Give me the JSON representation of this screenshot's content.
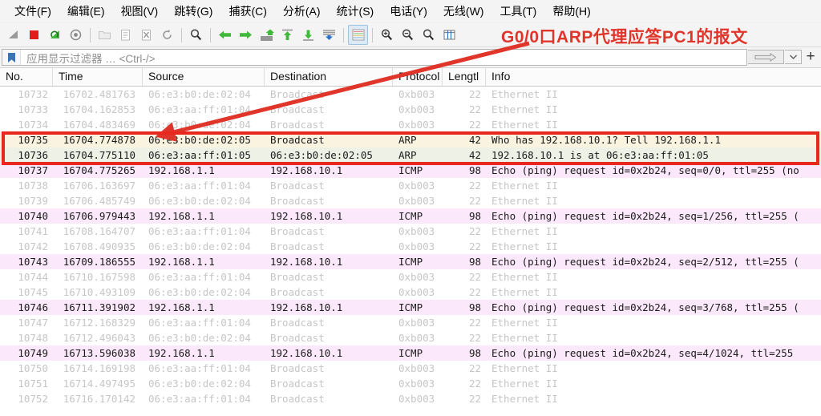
{
  "menu": {
    "items": [
      {
        "label": "文件(F)",
        "name": "menu-file"
      },
      {
        "label": "编辑(E)",
        "name": "menu-edit"
      },
      {
        "label": "视图(V)",
        "name": "menu-view"
      },
      {
        "label": "跳转(G)",
        "name": "menu-go"
      },
      {
        "label": "捕获(C)",
        "name": "menu-capture"
      },
      {
        "label": "分析(A)",
        "name": "menu-analyze"
      },
      {
        "label": "统计(S)",
        "name": "menu-statistics"
      },
      {
        "label": "电话(Y)",
        "name": "menu-telephony"
      },
      {
        "label": "无线(W)",
        "name": "menu-wireless"
      },
      {
        "label": "工具(T)",
        "name": "menu-tools"
      },
      {
        "label": "帮助(H)",
        "name": "menu-help"
      }
    ]
  },
  "toolbar": {
    "icons": [
      "start-capture-icon",
      "stop-capture-icon",
      "restart-capture-icon",
      "capture-options-icon",
      "open-file-icon",
      "save-file-icon",
      "close-file-icon",
      "reload-icon",
      "find-packet-icon",
      "go-back-icon",
      "go-forward-icon",
      "go-to-packet-icon",
      "go-first-packet-icon",
      "go-last-packet-icon",
      "autoscroll-icon",
      "colorize-icon",
      "zoom-in-icon",
      "zoom-out-icon",
      "zoom-reset-icon",
      "resize-columns-icon"
    ]
  },
  "filter": {
    "bookmark_icon": "bookmark-icon",
    "placeholder": "应用显示过滤器 … <Ctrl-/>",
    "value": "",
    "apply_icon": "apply-filter-arrow-icon",
    "dropdown_icon": "chevron-down-icon",
    "add_label": "+"
  },
  "annotation": {
    "text": "G0/0口ARP代理应答PC1的报文",
    "color": "#e0352b"
  },
  "packet_list": {
    "columns": [
      {
        "label": "No.",
        "name": "column-no"
      },
      {
        "label": "Time",
        "name": "column-time"
      },
      {
        "label": "Source",
        "name": "column-source"
      },
      {
        "label": "Destination",
        "name": "column-destination"
      },
      {
        "label": "Protocol",
        "name": "column-protocol"
      },
      {
        "label": "Lengtl",
        "name": "column-length"
      },
      {
        "label": "Info",
        "name": "column-info"
      }
    ],
    "rows": [
      {
        "no": "10732",
        "time": "16702.481763",
        "src": "06:e3:b0:de:02:04",
        "dst": "Broadcast",
        "proto": "0xb003",
        "len": "22",
        "info": "Ethernet II",
        "style": "row-eth"
      },
      {
        "no": "10733",
        "time": "16704.162853",
        "src": "06:e3:aa:ff:01:04",
        "dst": "Broadcast",
        "proto": "0xb003",
        "len": "22",
        "info": "Ethernet II",
        "style": "row-eth"
      },
      {
        "no": "10734",
        "time": "16704.483469",
        "src": "06:e3:b0:de:02:04",
        "dst": "Broadcast",
        "proto": "0xb003",
        "len": "22",
        "info": "Ethernet II",
        "style": "row-eth"
      },
      {
        "no": "10735",
        "time": "16704.774878",
        "src": "06:e3:b0:de:02:05",
        "dst": "Broadcast",
        "proto": "ARP",
        "len": "42",
        "info": "Who has 192.168.10.1? Tell 192.168.1.1",
        "style": "row-arp"
      },
      {
        "no": "10736",
        "time": "16704.775110",
        "src": "06:e3:aa:ff:01:05",
        "dst": "06:e3:b0:de:02:05",
        "proto": "ARP",
        "len": "42",
        "info": "192.168.10.1 is at 06:e3:aa:ff:01:05",
        "style": "row-arp2"
      },
      {
        "no": "10737",
        "time": "16704.775265",
        "src": "192.168.1.1",
        "dst": "192.168.10.1",
        "proto": "ICMP",
        "len": "98",
        "info": "Echo (ping) request  id=0x2b24, seq=0/0, ttl=255 (no",
        "style": "row-icmp"
      },
      {
        "no": "10738",
        "time": "16706.163697",
        "src": "06:e3:aa:ff:01:04",
        "dst": "Broadcast",
        "proto": "0xb003",
        "len": "22",
        "info": "Ethernet II",
        "style": "row-eth"
      },
      {
        "no": "10739",
        "time": "16706.485749",
        "src": "06:e3:b0:de:02:04",
        "dst": "Broadcast",
        "proto": "0xb003",
        "len": "22",
        "info": "Ethernet II",
        "style": "row-eth"
      },
      {
        "no": "10740",
        "time": "16706.979443",
        "src": "192.168.1.1",
        "dst": "192.168.10.1",
        "proto": "ICMP",
        "len": "98",
        "info": "Echo (ping) request  id=0x2b24, seq=1/256, ttl=255 (",
        "style": "row-icmp"
      },
      {
        "no": "10741",
        "time": "16708.164707",
        "src": "06:e3:aa:ff:01:04",
        "dst": "Broadcast",
        "proto": "0xb003",
        "len": "22",
        "info": "Ethernet II",
        "style": "row-eth"
      },
      {
        "no": "10742",
        "time": "16708.490935",
        "src": "06:e3:b0:de:02:04",
        "dst": "Broadcast",
        "proto": "0xb003",
        "len": "22",
        "info": "Ethernet II",
        "style": "row-eth"
      },
      {
        "no": "10743",
        "time": "16709.186555",
        "src": "192.168.1.1",
        "dst": "192.168.10.1",
        "proto": "ICMP",
        "len": "98",
        "info": "Echo (ping) request  id=0x2b24, seq=2/512, ttl=255 (",
        "style": "row-icmp"
      },
      {
        "no": "10744",
        "time": "16710.167598",
        "src": "06:e3:aa:ff:01:04",
        "dst": "Broadcast",
        "proto": "0xb003",
        "len": "22",
        "info": "Ethernet II",
        "style": "row-eth"
      },
      {
        "no": "10745",
        "time": "16710.493109",
        "src": "06:e3:b0:de:02:04",
        "dst": "Broadcast",
        "proto": "0xb003",
        "len": "22",
        "info": "Ethernet II",
        "style": "row-eth"
      },
      {
        "no": "10746",
        "time": "16711.391902",
        "src": "192.168.1.1",
        "dst": "192.168.10.1",
        "proto": "ICMP",
        "len": "98",
        "info": "Echo (ping) request  id=0x2b24, seq=3/768, ttl=255 (",
        "style": "row-icmp"
      },
      {
        "no": "10747",
        "time": "16712.168329",
        "src": "06:e3:aa:ff:01:04",
        "dst": "Broadcast",
        "proto": "0xb003",
        "len": "22",
        "info": "Ethernet II",
        "style": "row-eth"
      },
      {
        "no": "10748",
        "time": "16712.496043",
        "src": "06:e3:b0:de:02:04",
        "dst": "Broadcast",
        "proto": "0xb003",
        "len": "22",
        "info": "Ethernet II",
        "style": "row-eth"
      },
      {
        "no": "10749",
        "time": "16713.596038",
        "src": "192.168.1.1",
        "dst": "192.168.10.1",
        "proto": "ICMP",
        "len": "98",
        "info": "Echo (ping) request  id=0x2b24, seq=4/1024, ttl=255",
        "style": "row-icmp"
      },
      {
        "no": "10750",
        "time": "16714.169198",
        "src": "06:e3:aa:ff:01:04",
        "dst": "Broadcast",
        "proto": "0xb003",
        "len": "22",
        "info": "Ethernet II",
        "style": "row-eth"
      },
      {
        "no": "10751",
        "time": "16714.497495",
        "src": "06:e3:b0:de:02:04",
        "dst": "Broadcast",
        "proto": "0xb003",
        "len": "22",
        "info": "Ethernet II",
        "style": "row-eth"
      },
      {
        "no": "10752",
        "time": "16716.170142",
        "src": "06:e3:aa:ff:01:04",
        "dst": "Broadcast",
        "proto": "0xb003",
        "len": "22",
        "info": "Ethernet II",
        "style": "row-eth"
      }
    ]
  }
}
